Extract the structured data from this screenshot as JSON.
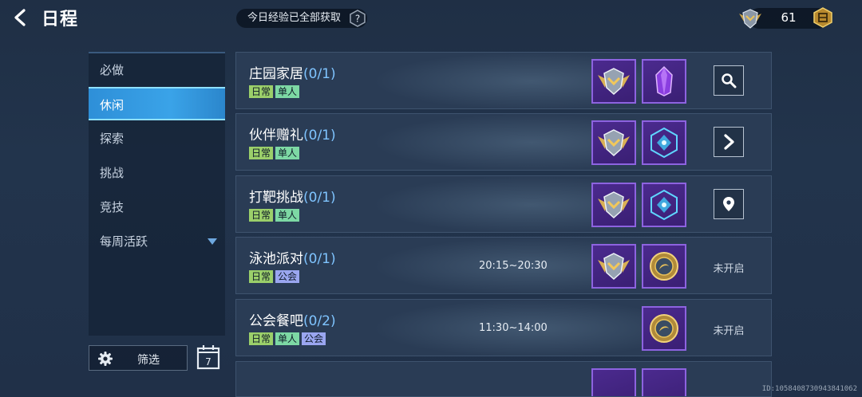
{
  "header": {
    "title": "日程",
    "xp_notice": "今日经验已全部获取",
    "currency_value": "61"
  },
  "sidebar": {
    "items": [
      {
        "label": "必做"
      },
      {
        "label": "休闲"
      },
      {
        "label": "探索"
      },
      {
        "label": "挑战"
      },
      {
        "label": "竞技"
      },
      {
        "label": "每周活跃"
      }
    ],
    "active_item": "休闲",
    "filter_label": "筛选",
    "calendar_day": "7"
  },
  "events": [
    {
      "title": "庄园家居",
      "progress": "(0/1)",
      "tags": [
        "日常",
        "单人"
      ],
      "time": "",
      "rewards": [
        "rank-badge-icon",
        "purple-crystal-icon"
      ],
      "action": "search-icon"
    },
    {
      "title": "伙伴赠礼",
      "progress": "(0/1)",
      "tags": [
        "日常",
        "单人"
      ],
      "time": "",
      "rewards": [
        "rank-badge-icon",
        "blue-gem-icon"
      ],
      "action": "arrow-right-icon"
    },
    {
      "title": "打靶挑战",
      "progress": "(0/1)",
      "tags": [
        "日常",
        "单人"
      ],
      "time": "",
      "rewards": [
        "rank-badge-icon",
        "blue-gem-icon"
      ],
      "action": "location-pin-icon"
    },
    {
      "title": "泳池派对",
      "progress": "(0/1)",
      "tags": [
        "日常",
        "公会"
      ],
      "time": "20:15~20:30",
      "rewards": [
        "rank-badge-icon",
        "gold-token-icon"
      ],
      "status": "未开启"
    },
    {
      "title": "公会餐吧",
      "progress": "(0/2)",
      "tags": [
        "日常",
        "单人",
        "公会"
      ],
      "time": "11:30~14:00",
      "rewards": [
        "gold-token-icon"
      ],
      "status": "未开启"
    }
  ],
  "footer_id": "ID:1058408730943841062",
  "colors": {
    "accent_blue": "#3aa3e8",
    "progress_blue": "#7fc4ff",
    "reward_purple": "#4b2a8e",
    "tag_daily": "#9bcf6a",
    "tag_solo": "#7dd8a4",
    "tag_guild": "#9aa6f0"
  }
}
